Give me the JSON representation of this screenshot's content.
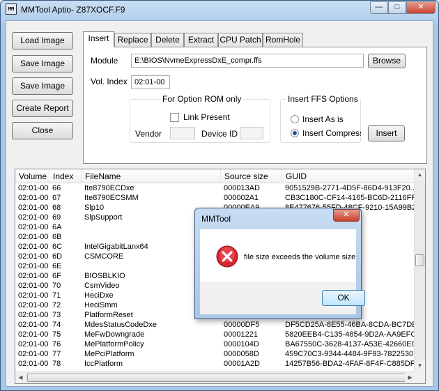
{
  "window": {
    "title": "MMTool Aptio- Z87XOCF.F9",
    "icon_text": "MM",
    "min_glyph": "—",
    "max_glyph": "□",
    "close_glyph": "✕"
  },
  "left_buttons": {
    "load": "Load Image",
    "save": "Save Image",
    "save_as": "Save Image as..",
    "report": "Create Report",
    "close": "Close"
  },
  "tabs": [
    "Insert",
    "Replace",
    "Delete",
    "Extract",
    "CPU Patch",
    "RomHole"
  ],
  "active_tab": "Insert",
  "insert": {
    "module_label": "Module",
    "module_value": "E:\\BIOS\\NvmeExpressDxE_compr.ffs",
    "browse": "Browse",
    "vol_index_label": "Vol. Index",
    "vol_index_value": "02:01-00",
    "option_rom_group": "For Option ROM only",
    "link_present": "Link Present",
    "vendor_label": "Vendor",
    "device_id_label": "Device ID",
    "ffs_group": "Insert FFS Options",
    "insert_as_is": "Insert As is",
    "insert_compressed": "Insert Compressed",
    "insert_button": "Insert"
  },
  "table": {
    "columns": [
      "Volume",
      "Index",
      "FileName",
      "Source size",
      "GUID"
    ],
    "rows": [
      [
        "02:01-00",
        "66",
        "Ite8790ECDxe",
        "000013AD",
        "9051529B-2771-4D5F-86D4-913F20..."
      ],
      [
        "02:01-00",
        "67",
        "Ite8790ECSMM",
        "000002A1",
        "CB3C180C-CF14-4165-BC6D-2116FF..."
      ],
      [
        "02:01-00",
        "68",
        "Slp10",
        "00000EA9",
        "8E477676-55FD-48CF-9210-15A99B2..."
      ],
      [
        "02:01-00",
        "69",
        "SlpSupport",
        "",
        "5429DF"
      ],
      [
        "02:01-00",
        "6A",
        "",
        "",
        "FEAD1C"
      ],
      [
        "02:01-00",
        "6B",
        "",
        "",
        "D318C8"
      ],
      [
        "02:01-00",
        "6C",
        "IntelGigabitLanx64",
        "",
        "0AC7745"
      ],
      [
        "02:01-00",
        "6D",
        "CSMCORE",
        "",
        "600BC4E"
      ],
      [
        "02:01-00",
        "6E",
        "",
        "",
        "38536E"
      ],
      [
        "02:01-00",
        "6F",
        "BIOSBLKIO",
        "",
        "5851E"
      ],
      [
        "02:01-00",
        "70",
        "CsmVideo",
        "",
        "887A3E"
      ],
      [
        "02:01-00",
        "71",
        "HeciDxe",
        "",
        "726A5"
      ],
      [
        "02:01-00",
        "72",
        "HeciSmm",
        "",
        "00D741"
      ],
      [
        "02:01-00",
        "73",
        "PlatformReset",
        "",
        "B44485A"
      ],
      [
        "02:01-00",
        "74",
        "MdesStatusCodeDxe",
        "00000DF5",
        "DF5CD25A-8E55-46BA-8CDA-BC7DE..."
      ],
      [
        "02:01-00",
        "75",
        "MeFwDowngrade",
        "00001221",
        "5820EEB4-C135-4854-9D2A-AA9EFC..."
      ],
      [
        "02:01-00",
        "76",
        "MePlatformPolicy",
        "0000104D",
        "BA67550C-3628-4137-A53E-42660E0..."
      ],
      [
        "02:01-00",
        "77",
        "MePciPlatform",
        "0000058D",
        "459C70C3-9344-4484-9F93-7822530..."
      ],
      [
        "02:01-00",
        "78",
        "IccPlatform",
        "00001A2D",
        "14257B56-BDA2-4FAF-8F4F-C885DF..."
      ]
    ],
    "scroll_up": "▲",
    "scroll_down": "▼",
    "scroll_left": "◀",
    "scroll_right": "▶"
  },
  "dialog": {
    "title": "MMTool",
    "close_glyph": "✕",
    "message": "file size exceeds the volume size",
    "ok": "OK"
  },
  "colors": {
    "title_bar": "#a9c7e6",
    "error_red": "#d7282f",
    "face": "#f0f0f0"
  }
}
